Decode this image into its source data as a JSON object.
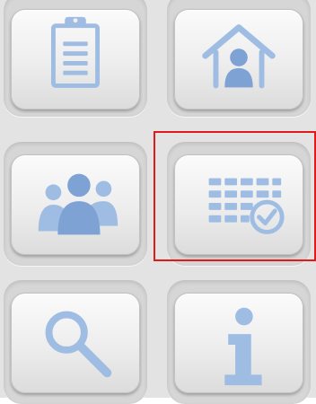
{
  "buttons": [
    {
      "id": "clipboard",
      "icon": "clipboard-icon"
    },
    {
      "id": "home",
      "icon": "home-user-icon"
    },
    {
      "id": "group",
      "icon": "group-users-icon"
    },
    {
      "id": "schedule",
      "icon": "calendar-check-icon"
    },
    {
      "id": "search",
      "icon": "search-icon"
    },
    {
      "id": "info",
      "icon": "info-icon"
    }
  ],
  "selected_button": "schedule",
  "colors": {
    "background": "#e3e3e3",
    "icon_blue": "#9fbde3",
    "icon_blue_dark": "#7ea2d4",
    "selection_outline": "#e01a1a"
  }
}
